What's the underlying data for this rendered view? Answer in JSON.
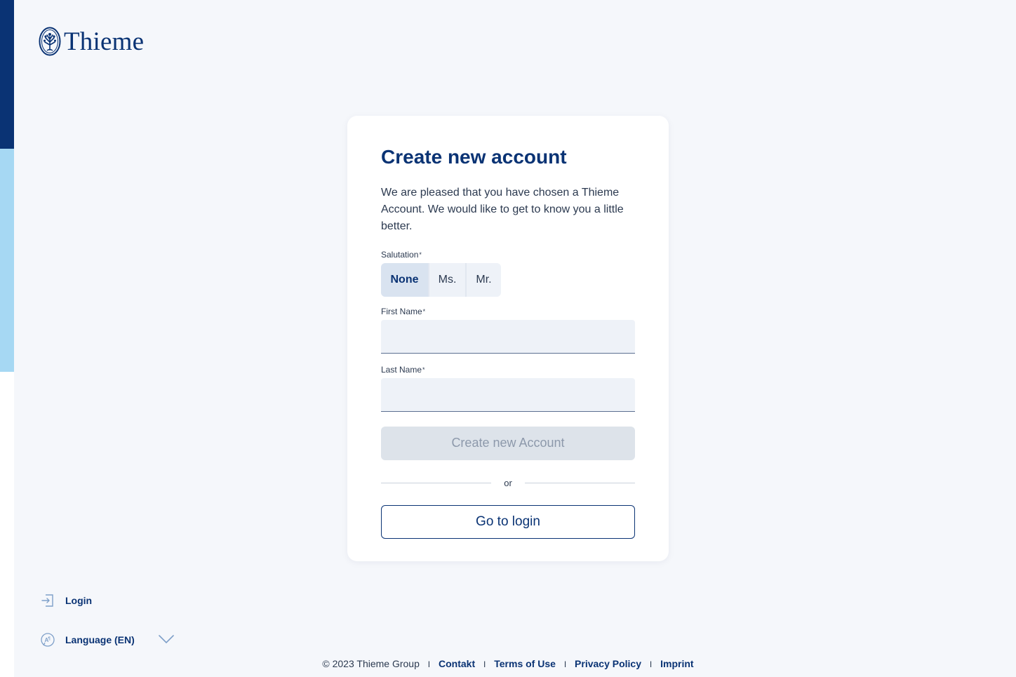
{
  "brand": {
    "name": "Thieme",
    "logo_icon": "tree-seal-icon",
    "color": "#0a3374"
  },
  "card": {
    "title": "Create new account",
    "intro": "We are pleased that you have chosen a Thieme Account. We would like to get to know you a little better.",
    "salutation": {
      "label": "Salutation",
      "required_mark": "*",
      "options": [
        "None",
        "Ms.",
        "Mr."
      ],
      "selected": "None"
    },
    "first_name": {
      "label": "First Name",
      "required_mark": "*",
      "value": ""
    },
    "last_name": {
      "label": "Last Name",
      "required_mark": "*",
      "value": ""
    },
    "create_button": "Create new Account",
    "or_text": "or",
    "login_button": "Go to login"
  },
  "sidebar": {
    "login": {
      "label": "Login",
      "icon": "login-icon"
    },
    "language": {
      "label": "Language (EN)",
      "icon": "language-icon",
      "chevron": "chevron-down-icon"
    }
  },
  "footer": {
    "copyright": "© 2023 Thieme Group",
    "separator": "I",
    "links": [
      "Contakt",
      "Terms of Use",
      "Privacy Policy",
      "Imprint"
    ]
  },
  "colors": {
    "accent": "#0a3374",
    "strip_light": "#a6d8f3",
    "background": "#f5f7fb",
    "disabled_button": "#dde3ea"
  }
}
